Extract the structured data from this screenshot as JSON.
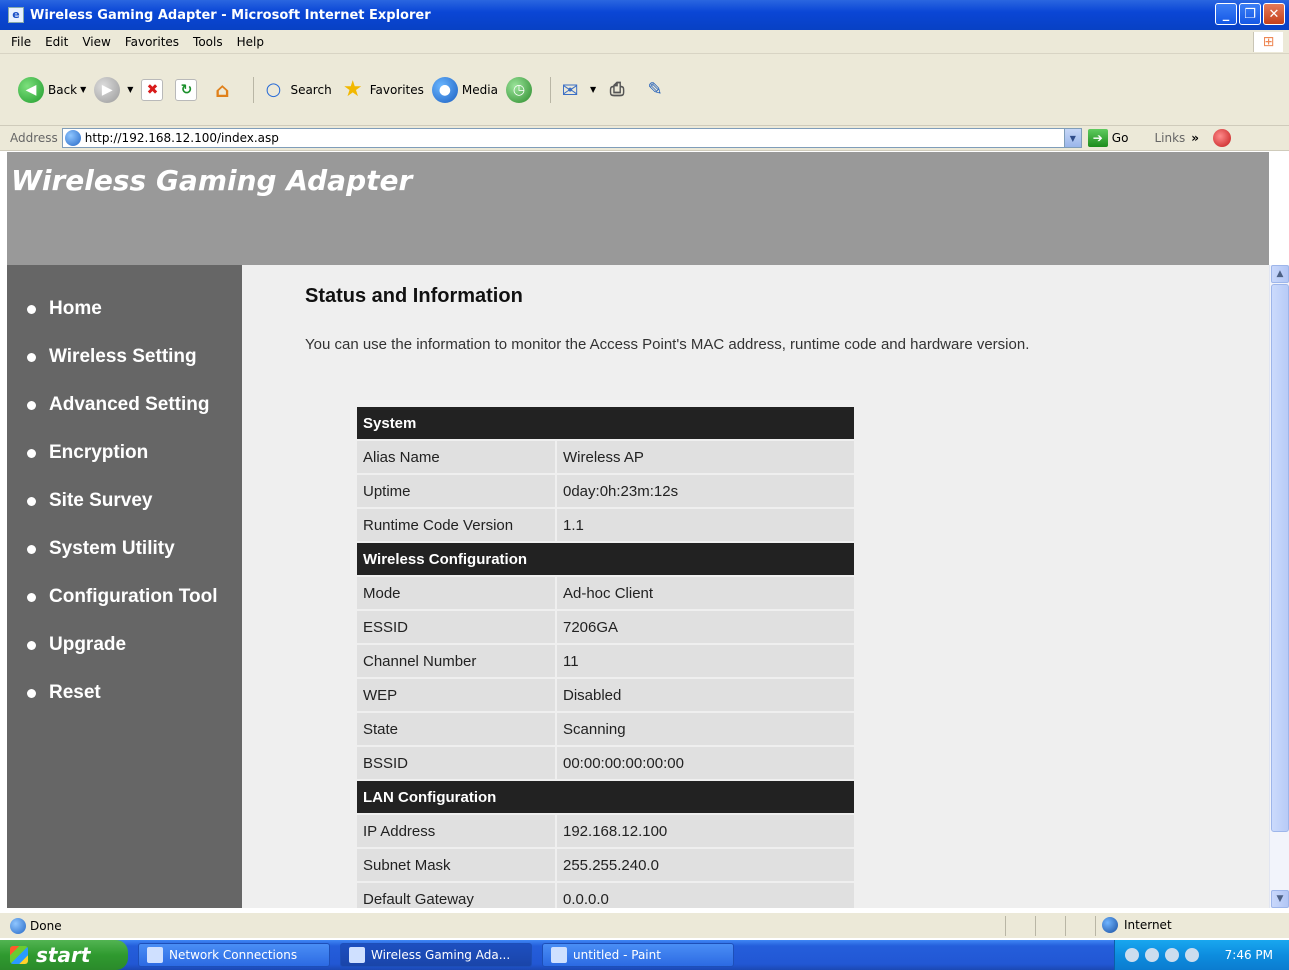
{
  "window": {
    "title": "Wireless Gaming Adapter - Microsoft Internet Explorer"
  },
  "menu": [
    "File",
    "Edit",
    "View",
    "Favorites",
    "Tools",
    "Help"
  ],
  "toolbar": {
    "back": "Back",
    "search": "Search",
    "favorites": "Favorites",
    "media": "Media"
  },
  "address": {
    "label": "Address",
    "url": "http://192.168.12.100/index.asp",
    "go": "Go",
    "links": "Links"
  },
  "page": {
    "brand": "Wireless Gaming Adapter",
    "nav": [
      "Home",
      "Wireless Setting",
      "Advanced Setting",
      "Encryption",
      "Site Survey",
      "System Utility",
      "Configuration Tool",
      "Upgrade",
      "Reset"
    ],
    "heading": "Status and Information",
    "intro": "You can use the information to monitor the Access Point's MAC address, runtime code and hardware version.",
    "sections": [
      {
        "title": "System",
        "rows": [
          {
            "label": "Alias Name",
            "value": "Wireless AP"
          },
          {
            "label": "Uptime",
            "value": "0day:0h:23m:12s"
          },
          {
            "label": "Runtime Code Version",
            "value": "1.1"
          }
        ]
      },
      {
        "title": "Wireless Configuration",
        "rows": [
          {
            "label": "Mode",
            "value": "Ad-hoc Client"
          },
          {
            "label": "ESSID",
            "value": "7206GA"
          },
          {
            "label": "Channel Number",
            "value": "11"
          },
          {
            "label": "WEP",
            "value": "Disabled"
          },
          {
            "label": "State",
            "value": "Scanning"
          },
          {
            "label": "BSSID",
            "value": "00:00:00:00:00:00"
          }
        ]
      },
      {
        "title": "LAN Configuration",
        "rows": [
          {
            "label": "IP Address",
            "value": "192.168.12.100"
          },
          {
            "label": "Subnet Mask",
            "value": "255.255.240.0"
          },
          {
            "label": "Default Gateway",
            "value": "0.0.0.0"
          }
        ]
      }
    ]
  },
  "status": {
    "text": "Done",
    "zone": "Internet"
  },
  "taskbar": {
    "start": "start",
    "tasks": [
      "Network Connections",
      "Wireless Gaming Ada...",
      "untitled - Paint"
    ],
    "clock": "7:46 PM"
  },
  "colors": {
    "banner": "#999999",
    "sidebar": "#666666",
    "content_bg": "#efefef",
    "section_header": "#222222"
  }
}
